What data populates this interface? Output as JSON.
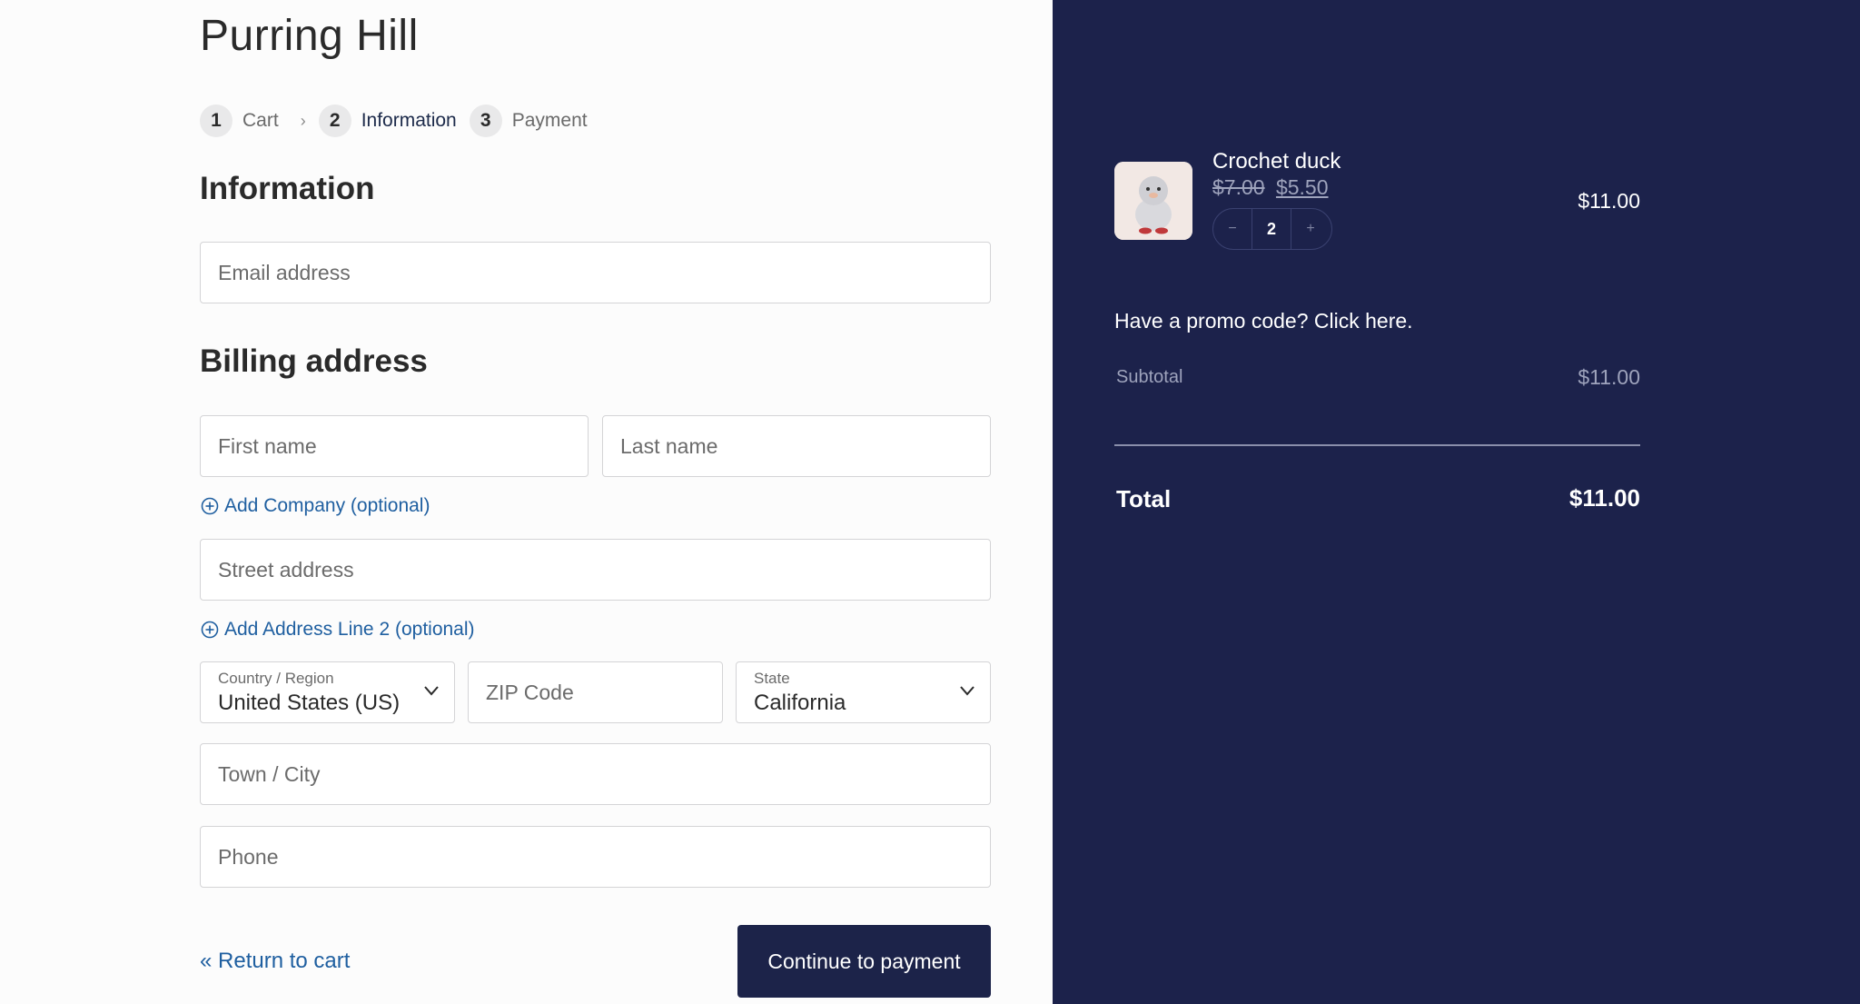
{
  "store": {
    "title": "Purring Hill"
  },
  "steps": [
    {
      "num": "1",
      "label": "Cart"
    },
    {
      "num": "2",
      "label": "Information"
    },
    {
      "num": "3",
      "label": "Payment"
    }
  ],
  "steps_separator": "›",
  "information": {
    "title": "Information",
    "email_placeholder": "Email address"
  },
  "billing": {
    "title": "Billing address",
    "first_name_placeholder": "First name",
    "last_name_placeholder": "Last name",
    "add_company_label": "Add Company (optional)",
    "street_placeholder": "Street address",
    "add_address2_label": "Add Address Line 2 (optional)",
    "country": {
      "label": "Country / Region",
      "value": "United States (US)"
    },
    "zip_placeholder": "ZIP Code",
    "state": {
      "label": "State",
      "value": "California"
    },
    "city_placeholder": "Town / City",
    "phone_placeholder": "Phone"
  },
  "actions": {
    "return_label": "« Return to cart",
    "continue_label": "Continue to payment"
  },
  "summary": {
    "product": {
      "name": "Crochet duck",
      "price_old": "$7.00",
      "price_new": "$5.50",
      "quantity": "2",
      "minus": "−",
      "plus": "+",
      "line_total": "$11.00"
    },
    "promo_text": "Have a promo code? Click here.",
    "subtotal_label": "Subtotal",
    "subtotal_value": "$11.00",
    "total_label": "Total",
    "total_value": "$11.00"
  },
  "colors": {
    "panel_bg": "#1c224b",
    "link": "#1f5fa0",
    "button_bg": "#1c2349"
  },
  "icons": {
    "add": "plus-circle-icon",
    "select": "chevron-down-icon",
    "step_separator": "chevron-right-icon",
    "product_thumb": "crochet-duck-image"
  }
}
